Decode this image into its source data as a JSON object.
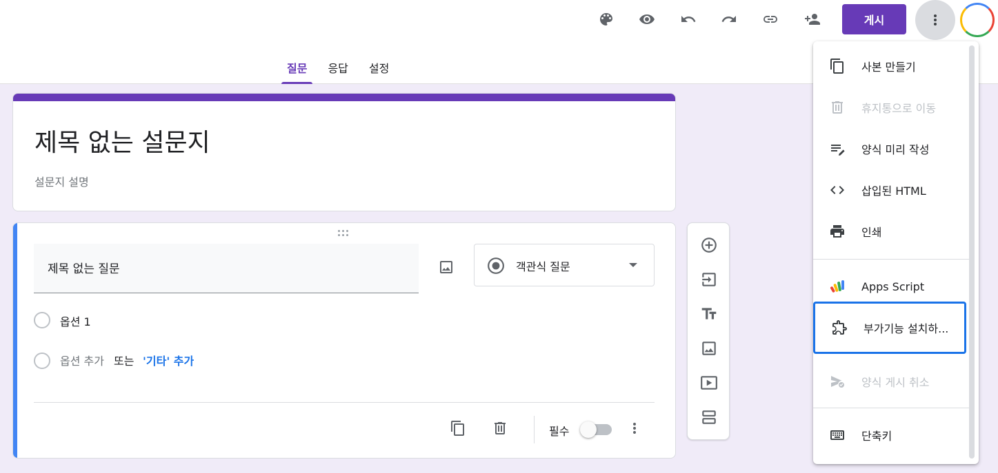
{
  "header": {
    "publish_label": "게시",
    "tabs": [
      {
        "label": "질문",
        "active": true
      },
      {
        "label": "응답",
        "active": false
      },
      {
        "label": "설정",
        "active": false
      }
    ],
    "icons": [
      "palette-icon",
      "preview-eye-icon",
      "undo-icon",
      "redo-icon",
      "link-icon",
      "add-collaborator-icon",
      "more-vert-icon"
    ]
  },
  "form": {
    "title": "제목 없는 설문지",
    "description": "설문지 설명"
  },
  "question": {
    "title": "제목 없는 질문",
    "type_label": "객관식 질문",
    "option1": "옵션 1",
    "add_option": "옵션 추가",
    "or_label": "또는",
    "add_other": "'기타' 추가",
    "required_label": "필수",
    "required_on": false
  },
  "menu": {
    "items": [
      {
        "label": "사본 만들기",
        "icon": "copy-icon",
        "disabled": false
      },
      {
        "label": "휴지통으로 이동",
        "icon": "trash-icon",
        "disabled": true
      },
      {
        "label": "양식 미리 작성",
        "icon": "prefill-icon",
        "disabled": false
      },
      {
        "label": "삽입된 HTML",
        "icon": "code-icon",
        "disabled": false
      },
      {
        "label": "인쇄",
        "icon": "print-icon",
        "disabled": false
      },
      {
        "label": "Apps Script",
        "icon": "apps-script-icon",
        "disabled": false
      },
      {
        "label": "부가기능 설치하...",
        "icon": "puzzle-icon",
        "disabled": false
      },
      {
        "label": "양식 게시 취소",
        "icon": "unpublish-icon",
        "disabled": true
      },
      {
        "label": "단축키",
        "icon": "keyboard-icon",
        "disabled": false
      }
    ]
  },
  "colors": {
    "accent": "#673ab7",
    "background": "#f0ebf8",
    "question_bar": "#4285f4",
    "focus": "#1a73e8",
    "link": "#1a73e8"
  }
}
